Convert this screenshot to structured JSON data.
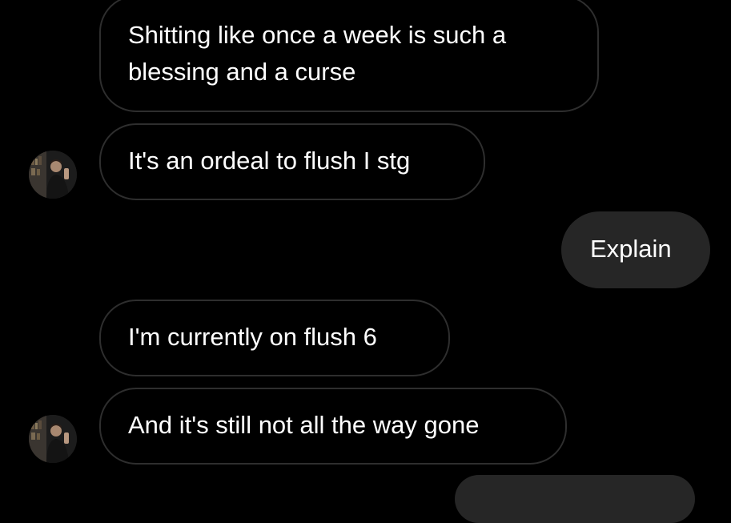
{
  "thread": {
    "messages": [
      {
        "sender": "them",
        "lines": [
          "Shitting like once a week is such a",
          "blessing and a curse"
        ]
      },
      {
        "sender": "them",
        "text": "It's an ordeal to flush I stg"
      },
      {
        "sender": "me",
        "text": "Explain"
      },
      {
        "sender": "them",
        "text": "I'm currently on flush 6"
      },
      {
        "sender": "them",
        "text": "And it's still not all the way gone"
      }
    ]
  },
  "colors": {
    "background": "#000000",
    "incoming_border": "#2e2e2e",
    "outgoing_fill": "#262626",
    "text": "#ffffff"
  },
  "icons": {
    "avatar": "user-avatar-photo"
  }
}
